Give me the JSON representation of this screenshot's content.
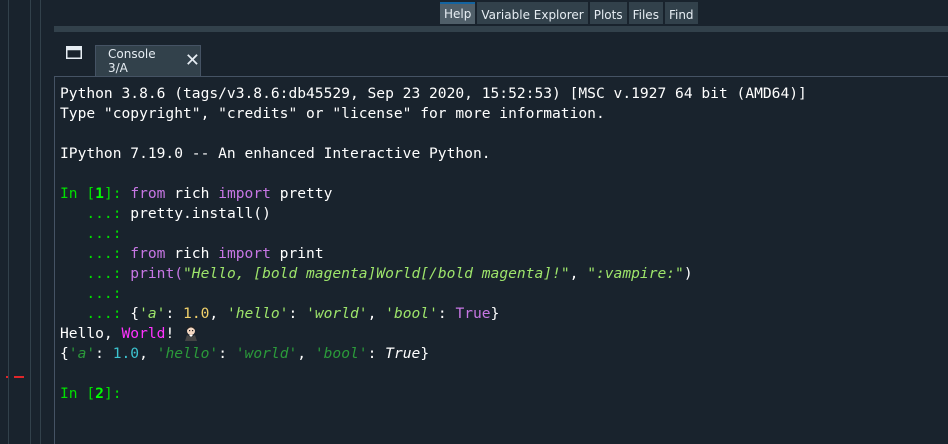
{
  "pane_tabs": [
    {
      "label": "Help",
      "active": true
    },
    {
      "label": "Variable Explorer",
      "active": false
    },
    {
      "label": "Plots",
      "active": false
    },
    {
      "label": "Files",
      "active": false
    },
    {
      "label": "Find",
      "active": false
    }
  ],
  "console_tab": {
    "label": "Console 3/A",
    "close_icon": "close-icon"
  },
  "console": {
    "banner_line1": "Python 3.8.6 (tags/v3.8.6:db45529, Sep 23 2020, 15:52:53) [MSC v.1927 64 bit (AMD64)]",
    "banner_line2": "Type \"copyright\", \"credits\" or \"license\" for more information.",
    "banner_line3": "IPython 7.19.0 -- An enhanced Interactive Python.",
    "prompt1_prefix": "In [",
    "prompt1_num": "1",
    "prompt1_suffix": "]: ",
    "cont": "   ...: ",
    "cont_empty": "   ...:",
    "kw_from": "from",
    "kw_import": "import",
    "mod_rich": " rich ",
    "name_pretty": " pretty",
    "line_install": "pretty.install()",
    "name_print": " print",
    "call_print": "print(",
    "str_hello": "\"Hello, [bold magenta]World[/bold magenta]!\"",
    "comma": ", ",
    "str_vampire": "\":vampire:\"",
    "close_paren": ")",
    "dict_open": "{",
    "key_a": "'a'",
    "colon": ": ",
    "val_num": "1.0",
    "key_hello": "'hello'",
    "val_world": "'world'",
    "key_bool": "'bool'",
    "val_true": "True",
    "dict_close": "}",
    "out_hello": "Hello, ",
    "out_world": "World",
    "out_bang": "! ",
    "prompt2_prefix": "In [",
    "prompt2_num": "2",
    "prompt2_suffix": "]:"
  },
  "colors": {
    "background": "#19232d",
    "prompt": "#00e000",
    "keyword": "#c777e4",
    "string": "#9ee56b",
    "magenta": "#ff33ff",
    "accent": "#1464a0"
  }
}
